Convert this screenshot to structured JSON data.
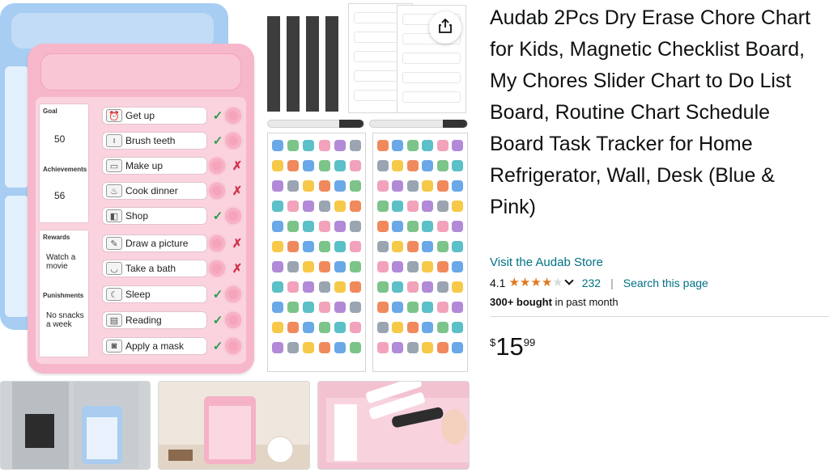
{
  "product": {
    "title": "Audab 2Pcs Dry Erase Chore Chart for Kids, Magnetic Checklist Board, My Chores Slider Chart to Do List Board, Routine Chart Schedule Board Task Tracker for Home Refrigerator, Wall, Desk (Blue & Pink)",
    "store_link": "Visit the Audab Store",
    "rating": {
      "value": "4.1",
      "stars": 4.1,
      "count": "232",
      "star_color": "#de7921"
    },
    "search_page": "Search this page",
    "separator": "|",
    "bought": {
      "bold": "300+ bought",
      "rest": " in past month"
    },
    "price": {
      "symbol": "$",
      "whole": "15",
      "fraction": "99"
    }
  },
  "board": {
    "goal_label": "Goal",
    "goal_value": "50",
    "achievements_label": "Achievements",
    "achievements_value": "56",
    "rewards_label": "Rewards",
    "rewards_text": "Watch a movie",
    "punishments_label": "Punishments",
    "punishments_text": "No snacks a week",
    "tasks": [
      {
        "label": "Get up",
        "icon": "alarm-clock-icon",
        "status": "done",
        "mark": "✓"
      },
      {
        "label": "Brush teeth",
        "icon": "toothbrush-icon",
        "status": "done",
        "mark": "✓"
      },
      {
        "label": "Make up",
        "icon": "bed-icon",
        "status": "not-done",
        "mark": "✗"
      },
      {
        "label": "Cook dinner",
        "icon": "cooking-icon",
        "status": "not-done",
        "mark": "✗"
      },
      {
        "label": "Shop",
        "icon": "shopping-icon",
        "status": "done",
        "mark": "✓"
      },
      {
        "label": "Draw a picture",
        "icon": "drawing-icon",
        "status": "not-done",
        "mark": "✗"
      },
      {
        "label": "Take a bath",
        "icon": "bathtub-icon",
        "status": "not-done",
        "mark": "✗"
      },
      {
        "label": "Sleep",
        "icon": "sleep-icon",
        "status": "done",
        "mark": "✓"
      },
      {
        "label": "Reading",
        "icon": "book-icon",
        "status": "done",
        "mark": "✓"
      },
      {
        "label": "Apply a mask",
        "icon": "mask-icon",
        "status": "done",
        "mark": "✓"
      }
    ]
  },
  "thumbnails": [
    {
      "name": "fridge-thumbnail"
    },
    {
      "name": "desk-thumbnail"
    },
    {
      "name": "marker-closeup-thumbnail"
    }
  ],
  "colors": {
    "link": "#007185",
    "pink_board": "#f7b7cb",
    "blue_board": "#a7cdf2",
    "check": "#2a9d4a",
    "cross": "#d0344b"
  },
  "share_icon": "share-icon"
}
